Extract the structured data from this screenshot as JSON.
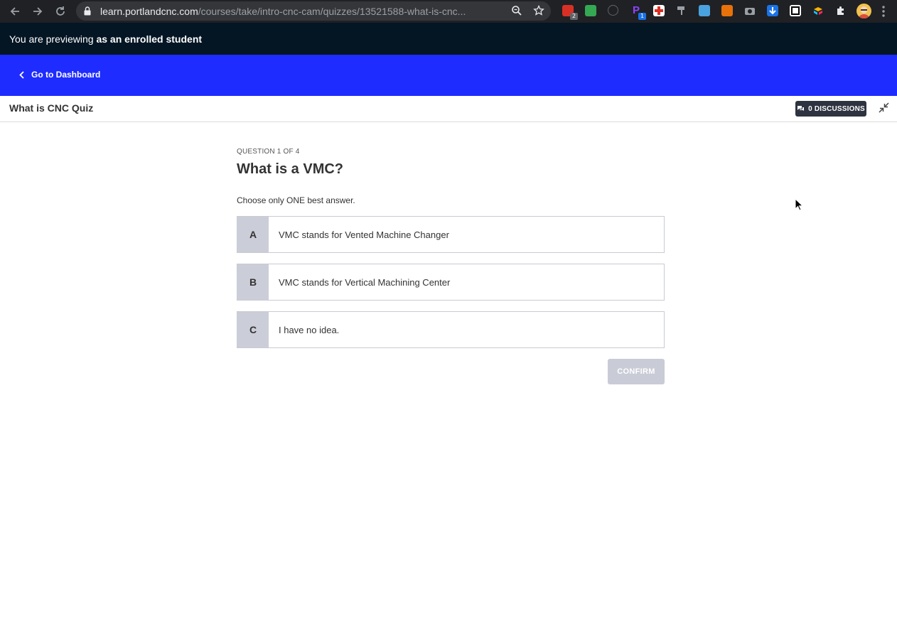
{
  "browser": {
    "url_host": "learn.portlandcnc.com",
    "url_path": "/courses/take/intro-cnc-cam/quizzes/13521588-what-is-cnc...",
    "extension_badges": [
      "2",
      "1"
    ]
  },
  "preview_bar": {
    "prefix": "You are previewing ",
    "emphasis": "as an enrolled student"
  },
  "header": {
    "dashboard_link": "Go to Dashboard",
    "brand_color": "#1e2cff"
  },
  "lesson": {
    "title": "What is CNC Quiz",
    "discussions_label": "0 DISCUSSIONS"
  },
  "quiz": {
    "counter": "QUESTION 1 OF 4",
    "question": "What is a VMC?",
    "instruction": "Choose only ONE best answer.",
    "answers": [
      {
        "letter": "A",
        "text": "VMC stands for Vented Machine Changer"
      },
      {
        "letter": "B",
        "text": "VMC stands for Vertical Machining Center"
      },
      {
        "letter": "C",
        "text": "I have no idea."
      }
    ],
    "confirm_label": "CONFIRM"
  }
}
